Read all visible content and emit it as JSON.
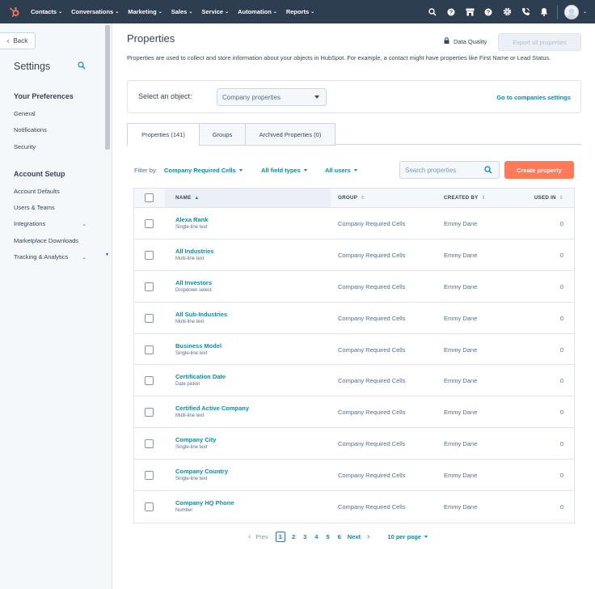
{
  "topnav": {
    "items": [
      {
        "label": "Contacts"
      },
      {
        "label": "Conversations"
      },
      {
        "label": "Marketing"
      },
      {
        "label": "Sales"
      },
      {
        "label": "Service"
      },
      {
        "label": "Automation"
      },
      {
        "label": "Reports"
      }
    ],
    "icons": [
      "search-icon",
      "help-circle-icon",
      "marketplace-icon",
      "help-icon",
      "settings-icon",
      "calling-icon",
      "notifications-icon"
    ],
    "brand_color": "#ff7a59",
    "bg_color": "#2d3e50"
  },
  "sidebar": {
    "back_label": "Back",
    "title": "Settings",
    "sections": [
      {
        "heading": "Your Preferences",
        "links": [
          "General",
          "Notifications",
          "Security"
        ]
      },
      {
        "heading": "Account Setup",
        "links": [
          "Account Defaults",
          "Users & Teams",
          "Integrations",
          "Marketplace Downloads",
          "Tracking & Analytics"
        ]
      }
    ]
  },
  "main": {
    "title": "Properties",
    "data_quality_label": "Data Quality",
    "export_label": "Export all properties",
    "description": "Properties are used to collect and store information about your objects in HubSpot. For example, a contact might have properties like First Name or Lead Status.",
    "select_label": "Select an object:",
    "select_value": "Company properties",
    "goto_link": "Go to companies settings",
    "tabs": [
      {
        "label": "Properties (141)"
      },
      {
        "label": "Groups"
      },
      {
        "label": "Archived Properties (0)"
      }
    ],
    "filter_label": "Filter by:",
    "filters": [
      "Company Required Cells",
      "All field types",
      "All users"
    ],
    "search_placeholder": "Search properties",
    "create_label": "Create property",
    "accent_color": "#0091ae",
    "columns": [
      "NAME",
      "GROUP",
      "CREATED BY",
      "USED IN"
    ],
    "rows": [
      {
        "name": "Alexa Rank",
        "type": "Single-line text",
        "group": "Company Required Cells",
        "created_by": "Emmy Dane",
        "used_in": "0"
      },
      {
        "name": "All Industries",
        "type": "Multi-line text",
        "group": "Company Required Cells",
        "created_by": "Emmy Dane",
        "used_in": "0"
      },
      {
        "name": "All Investors",
        "type": "Dropdown select",
        "group": "Company Required Cells",
        "created_by": "Emmy Dane",
        "used_in": "0"
      },
      {
        "name": "All Sub-Industries",
        "type": "Multi-line text",
        "group": "Company Required Cells",
        "created_by": "Emmy Dane",
        "used_in": "0"
      },
      {
        "name": "Business Model",
        "type": "Single-line text",
        "group": "Company Required Cells",
        "created_by": "Emmy Dane",
        "used_in": "0"
      },
      {
        "name": "Certification Date",
        "type": "Date picker",
        "group": "Company Required Cells",
        "created_by": "Emmy Dane",
        "used_in": "0"
      },
      {
        "name": "Certified Active Company",
        "type": "Multi-line text",
        "group": "Company Required Cells",
        "created_by": "Emmy Dane",
        "used_in": "0"
      },
      {
        "name": "Company City",
        "type": "Single-line text",
        "group": "Company Required Cells",
        "created_by": "Emmy Dane",
        "used_in": "0"
      },
      {
        "name": "Company Country",
        "type": "Single-line text",
        "group": "Company Required Cells",
        "created_by": "Emmy Dane",
        "used_in": "0"
      },
      {
        "name": "Company HQ Phone",
        "type": "Number",
        "group": "Company Required Cells",
        "created_by": "Emmy Dane",
        "used_in": "0"
      }
    ],
    "pager": {
      "prev_label": "Prev",
      "pages": [
        "1",
        "2",
        "3",
        "4",
        "5",
        "6"
      ],
      "current_page": "1",
      "next_label": "Next",
      "per_page_label": "10 per page"
    }
  }
}
